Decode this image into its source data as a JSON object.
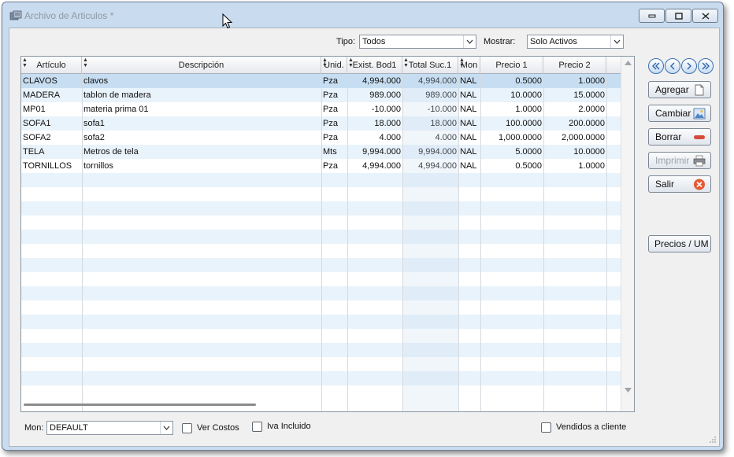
{
  "window": {
    "title": "Archivo de Articulos *"
  },
  "filters": {
    "tipo_label": "Tipo:",
    "tipo_value": "Todos",
    "mostrar_label": "Mostrar:",
    "mostrar_value": "Solo Activos"
  },
  "table": {
    "columns": [
      "Artículo",
      "Descripción",
      "Unid.",
      "Exist. Bod1",
      "Total Suc.1",
      "Mon",
      "Precio 1",
      "Precio 2"
    ],
    "rows": [
      [
        "CLAVOS",
        "clavos",
        "Pza",
        "4,994.000",
        "4,994.000",
        "NAL",
        "0.5000",
        "1.0000"
      ],
      [
        "MADERA",
        "tablon de madera",
        "Pza",
        "989.000",
        "989.000",
        "NAL",
        "10.0000",
        "15.0000"
      ],
      [
        "MP01",
        "materia prima 01",
        "Pza",
        "-10.000",
        "-10.000",
        "NAL",
        "1.0000",
        "2.0000"
      ],
      [
        "SOFA1",
        "sofa1",
        "Pza",
        "18.000",
        "18.000",
        "NAL",
        "100.0000",
        "200.0000"
      ],
      [
        "SOFA2",
        "sofa2",
        "Pza",
        "4.000",
        "4.000",
        "NAL",
        "1,000.0000",
        "2,000.0000"
      ],
      [
        "TELA",
        "Metros de tela",
        "Mts",
        "9,994.000",
        "9,994.000",
        "NAL",
        "5.0000",
        "10.0000"
      ],
      [
        "TORNILLOS",
        "tornillos",
        "Pza",
        "4,994.000",
        "4,994.000",
        "NAL",
        "0.5000",
        "1.0000"
      ]
    ],
    "selected_row": 0
  },
  "actions": {
    "agregar": "Agregar",
    "cambiar": "Cambiar",
    "borrar": "Borrar",
    "imprimir": "Imprimir",
    "salir": "Salir",
    "precios": "Precios / UM"
  },
  "footer": {
    "mon_label": "Mon:",
    "mon_value": "DEFAULT",
    "ver_costos": "Ver Costos",
    "iva_incluido": "Iva Incluido",
    "vendidos": "Vendidos a cliente"
  },
  "icons": {
    "app": "app-icon",
    "minimize": "minimize-icon",
    "restore": "restore-icon",
    "close": "close-icon",
    "nav": [
      "first-record-icon",
      "previous-record-icon",
      "next-record-icon",
      "last-record-icon"
    ],
    "agregar": "new-document-icon",
    "cambiar": "edit-picture-icon",
    "borrar": "remove-icon",
    "imprimir": "printer-icon",
    "salir": "cancel-circle-icon"
  },
  "colors": {
    "window_frame": "#c9dbee",
    "row_alt": "#e9f3fb",
    "row_selected": "#c7def2",
    "nav_blue": "#3b6fb0",
    "borrar_red": "#d64a3a",
    "salir_orange": "#e8572f"
  }
}
